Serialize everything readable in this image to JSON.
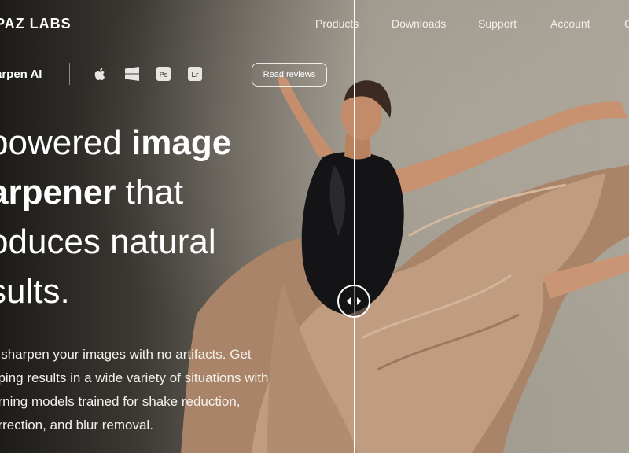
{
  "brand": {
    "logo_text": "PAZ LABS"
  },
  "nav": [
    {
      "label": "Products",
      "name": "nav-products"
    },
    {
      "label": "Downloads",
      "name": "nav-downloads"
    },
    {
      "label": "Support",
      "name": "nav-support"
    },
    {
      "label": "Account",
      "name": "nav-account"
    },
    {
      "label": "C",
      "name": "nav-cart"
    }
  ],
  "product": {
    "name": "arpen AI",
    "platform_icons": [
      "apple-icon",
      "windows-icon",
      "photoshop-icon",
      "lightroom-icon"
    ],
    "ps_label": "Ps",
    "lr_label": "Lr",
    "review_button": "Read reviews"
  },
  "headline": {
    "line1_a": "powered ",
    "line1_b": "image",
    "line2_a": "arpener",
    "line2_b": " that",
    "line3": "oduces natural",
    "line4": "sults."
  },
  "description": {
    "line1": "y sharpen your images with no artifacts. Get",
    "line2": "pping results in a wide variety of situations with",
    "line3": "arning models trained for shake reduction,",
    "line4": "orrection, and blur removal."
  },
  "comparison": {
    "handle_icon": "split-arrows-icon"
  },
  "colors": {
    "text": "#ffffff",
    "skirt": "#b89376",
    "top": "#141416"
  }
}
